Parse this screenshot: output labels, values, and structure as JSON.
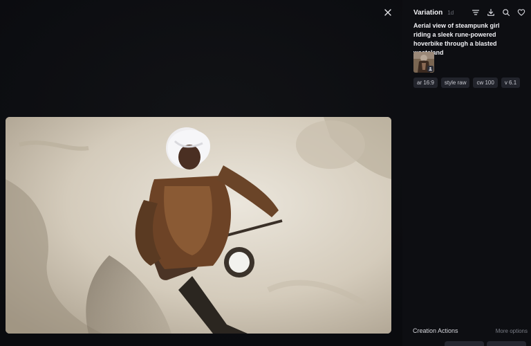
{
  "viewer": {
    "close_icon": "close-icon"
  },
  "panel": {
    "title": "Variation",
    "age": "1d",
    "header_icons": [
      "filter-lines-icon",
      "download-icon",
      "search-icon",
      "heart-icon"
    ],
    "prompt": "Aerial view of steampunk girl riding a sleek rune-powered hoverbike through a blasted wasteland",
    "reference_badge_icon": "person-icon",
    "params": [
      {
        "label": "ar 16:9"
      },
      {
        "label": "style raw"
      },
      {
        "label": "cw 100"
      },
      {
        "label": "v 6.1"
      }
    ],
    "creation_actions": {
      "title": "Creation Actions",
      "more_label": "More options"
    }
  },
  "colors": {
    "background": "#0b0c10",
    "panel_bg": "#0d0e12",
    "chip_bg": "#22242c",
    "text_primary": "#f0f0f4",
    "text_muted": "#6c6f78"
  }
}
